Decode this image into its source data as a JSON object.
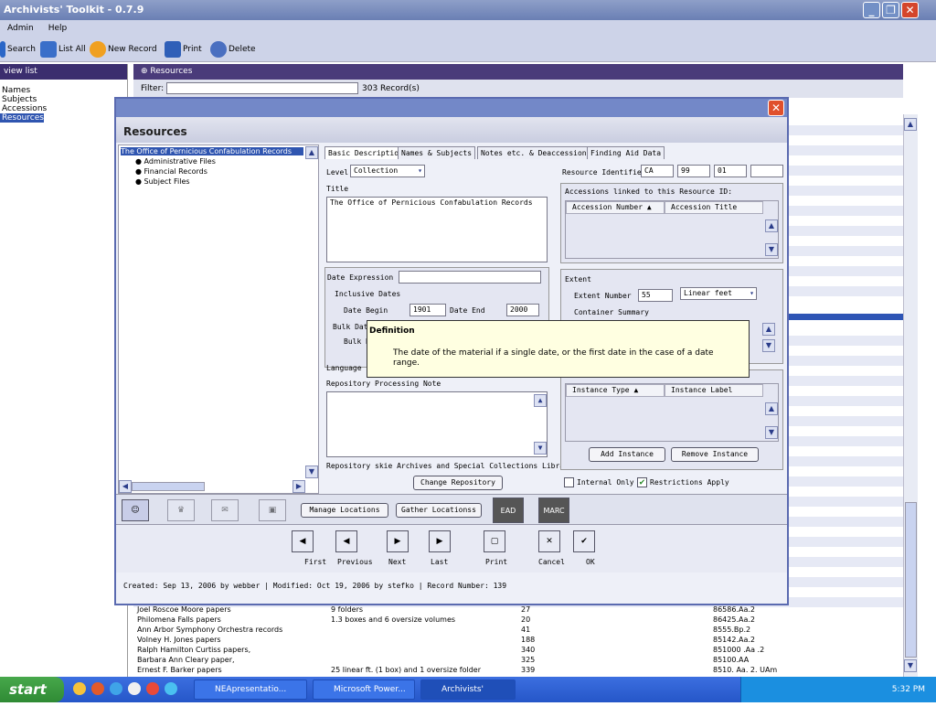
{
  "app": {
    "title": "Archivists' Toolkit - 0.7.9"
  },
  "menu": [
    "Admin",
    "Help"
  ],
  "toolbar": {
    "search": "Search",
    "list_all": "List All",
    "new_record": "New Record",
    "print": "Print",
    "delete": "Delete"
  },
  "left_panel": {
    "header": "view list",
    "items": [
      "Names",
      "Subjects",
      "Accessions",
      "Resources"
    ]
  },
  "main": {
    "header": "Resources",
    "filter_label": "Filter:",
    "record_count": "303 Record(s)"
  },
  "rows": [
    {
      "title": "Joel Roscoe Moore papers",
      "extent": "9 folders",
      "number": "27",
      "id": "86586.Aa.2"
    },
    {
      "title": "Philomena Falls papers",
      "extent": "1.3 boxes and 6 oversize volumes",
      "number": "20",
      "id": "86425.Aa.2"
    },
    {
      "title": "Ann Arbor Symphony Orchestra records",
      "extent": "",
      "number": "41",
      "id": "8555.Bp.2"
    },
    {
      "title": "Volney H. Jones papers",
      "extent": "",
      "number": "188",
      "id": "85142.Aa.2"
    },
    {
      "title": "Ralph Hamilton Curtiss papers,",
      "extent": "",
      "number": "340",
      "id": "851000 .Aa .2"
    },
    {
      "title": "Barbara Ann Cleary paper,",
      "extent": "",
      "number": "325",
      "id": "85100.AA"
    },
    {
      "title": "Ernest F. Barker papers",
      "extent": "25 linear ft. (1 box) and 1 oversize folder",
      "number": "339",
      "id": "8510. Aa. 2. UAm"
    }
  ],
  "dialog": {
    "header": "Resources",
    "tree": {
      "root": "The Office of Pernicious Confabulation Records",
      "children": [
        "Administrative Files",
        "Financial Records",
        "Subject Files"
      ]
    },
    "tabs": [
      "Basic Description",
      "Names & Subjects",
      "Notes etc. & Deaccessions",
      "Finding Aid Data"
    ],
    "level": {
      "label": "Level",
      "value": "Collection"
    },
    "title_label": "Title",
    "title_value": "The Office of Pernicious Confabulation Records",
    "date_expression_label": "Date Expression",
    "inclusive_dates": "Inclusive Dates",
    "date_begin_label": "Date Begin",
    "date_begin": "1901",
    "date_end_label": "Date End",
    "date_end": "2000",
    "bulk_dates": "Bulk Date",
    "bulk_d": "Bulk D",
    "language": "Language",
    "processing_note": "Repository Processing Note",
    "repository_label": "Repository",
    "repository_value": "skie Archives and Special Collections Library",
    "change_repository": "Change Repository",
    "resource_identifier": {
      "label": "Resource Identifier",
      "v1": "CA",
      "v2": "99",
      "v3": "01",
      "v4": ""
    },
    "accessions": {
      "label": "Accessions linked to this Resource ID:",
      "col1": "Accession Number",
      "col2": "Accession Title"
    },
    "extent": {
      "label": "Extent",
      "number_label": "Extent Number",
      "number": "55",
      "unit": "Linear feet",
      "container": "Container Summary"
    },
    "instances": {
      "col1": "Instance Type",
      "col2": "Instance Label",
      "add": "Add Instance",
      "remove": "Remove Instance"
    },
    "internal_only": "Internal Only",
    "restrictions": "Restrictions Apply",
    "manage_locations": "Manage Locations",
    "gather_locations": "Gather Locationss",
    "ead": "EAD",
    "marc": "MARC",
    "nav": {
      "first": "First",
      "previous": "Previous",
      "next": "Next",
      "last": "Last",
      "print": "Print",
      "cancel": "Cancel",
      "ok": "OK"
    },
    "footer": "Created: Sep 13, 2006 by webber | Modified: Oct 19, 2006 by stefko | Record Number: 139"
  },
  "tooltip": {
    "title": "Definition",
    "text": "The date of the material if a single date, or the first date in the case of a date range."
  },
  "taskbar": {
    "start": "start",
    "tasks": [
      "NEApresentatio...",
      "Microsoft Power...",
      "Archivists' Toolki..."
    ],
    "clock": "5:32 PM"
  }
}
